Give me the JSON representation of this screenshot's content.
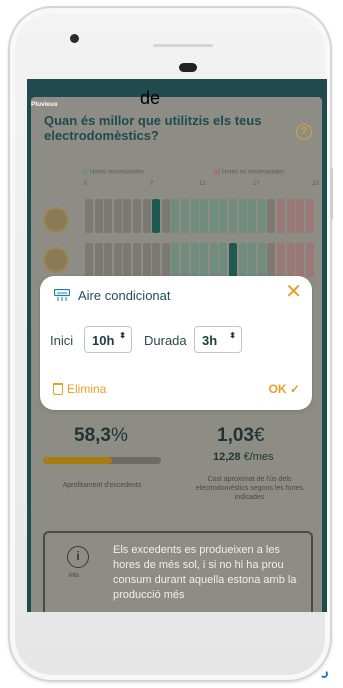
{
  "screen": {
    "top_tag": "Pluvieux",
    "question": "Quan és millor que utilitzis els teus electrodomèstics?",
    "help_icon": "?",
    "overlay_text": "de"
  },
  "legend": {
    "recommended": "Hores recomanades",
    "not_recommended": "Hores no recomanades"
  },
  "hour_ticks": [
    "0",
    "7",
    "12",
    "17",
    "23"
  ],
  "appliance_rows": [
    {
      "icon": "washing-machine",
      "selected_hours": [
        7
      ]
    },
    {
      "icon": "dishwasher",
      "selected_hours": [
        15
      ]
    }
  ],
  "modal": {
    "title": "Aire condicionat",
    "start_label": "Inici",
    "start_value": "10h",
    "duration_label": "Durada",
    "duration_value": "3h",
    "delete_label": "Elimina",
    "ok_label": "OK",
    "ok_check": "✓",
    "close_glyph": "✕",
    "stepper_glyph": "⬍"
  },
  "stats": {
    "surplus_value": "58,3",
    "surplus_unit": "%",
    "surplus_fraction": 0.583,
    "surplus_caption": "Aprofitament d'excedents",
    "cost_value": "1,03",
    "cost_unit": "€",
    "per_month_value": "12,28",
    "per_month_unit": "€/mes",
    "cost_caption": "Cost aproximat de l'ús dels electrodomèstics segons les hores indicades"
  },
  "info": {
    "icon_glyph": "i",
    "icon_label": "info",
    "text": "Els excedents es produeixen a les hores de més sol, i si no hi ha prou consum durant aquella estona amb la producció més"
  },
  "colors": {
    "accent": "#e3a02a",
    "title": "#1e5058",
    "screen_bg": "#214a4f",
    "dimmed_card": "#8d8d85"
  }
}
